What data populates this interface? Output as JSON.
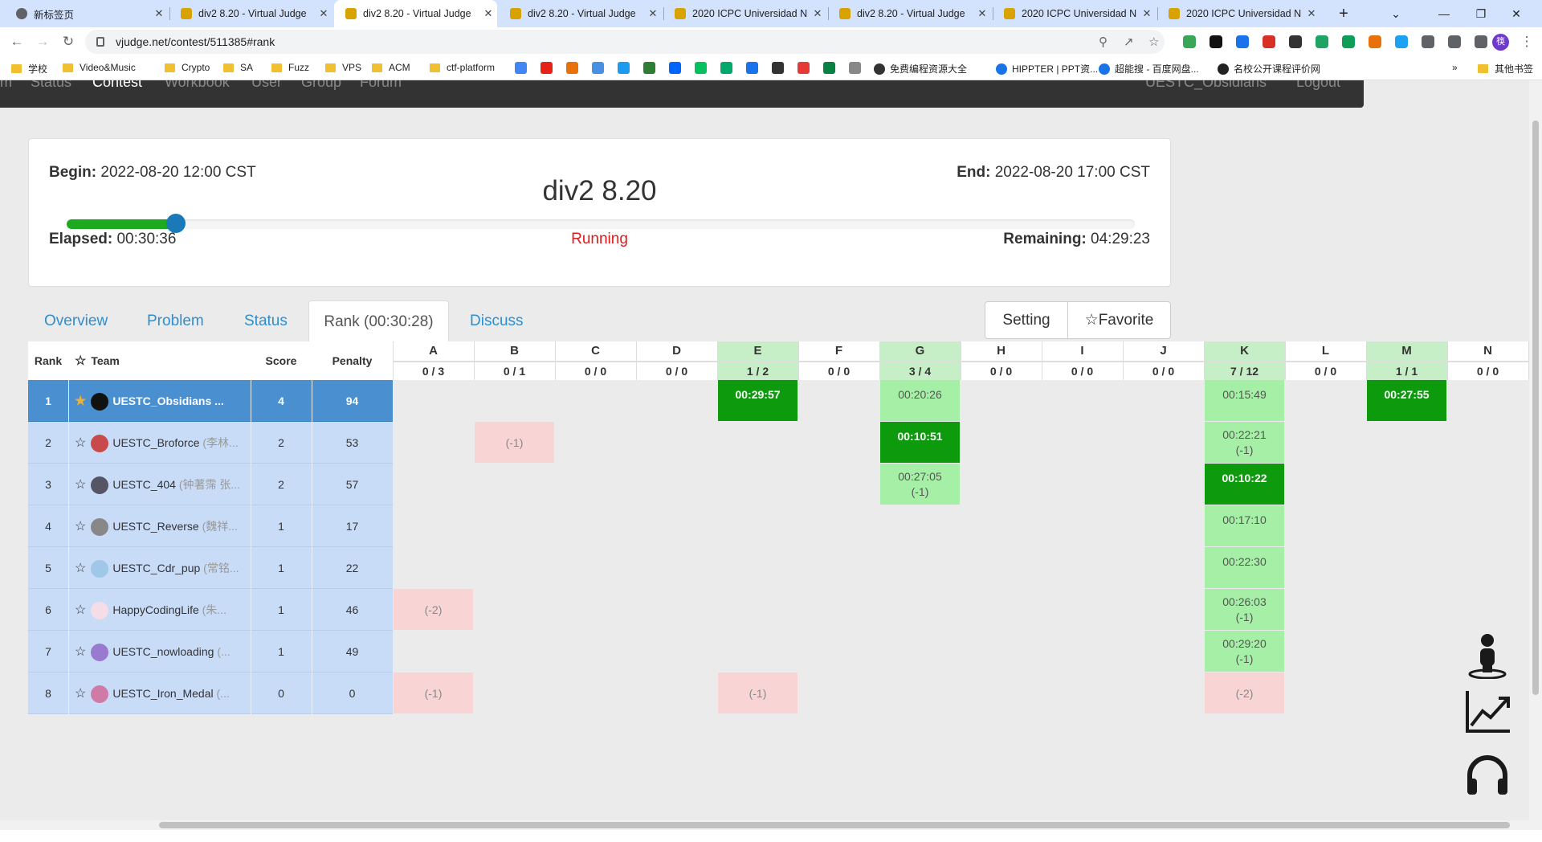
{
  "browser": {
    "tabs": [
      {
        "label": "新标签页",
        "active": false
      },
      {
        "label": "div2 8.20 - Virtual Judge",
        "active": false
      },
      {
        "label": "div2 8.20 - Virtual Judge",
        "active": true
      },
      {
        "label": "div2 8.20 - Virtual Judge",
        "active": false
      },
      {
        "label": "2020 ICPC Universidad N",
        "active": false
      },
      {
        "label": "div2 8.20 - Virtual Judge",
        "active": false
      },
      {
        "label": "2020 ICPC Universidad N",
        "active": false
      },
      {
        "label": "2020 ICPC Universidad N",
        "active": false
      }
    ],
    "new_tab": "+",
    "url": "vjudge.net/contest/511385#rank",
    "bookmarks": [
      "学校",
      "Video&Music",
      "Crypto",
      "SA",
      "Fuzz",
      "VPS",
      "ACM",
      "ctf-platform",
      "免费编程资源大全",
      "HIPPTER | PPT资...",
      "超能搜 - 百度网盘...",
      "名校公开课程评价网"
    ],
    "bookmarks_more": "»",
    "other_bookmarks": "其他书签",
    "profile_initial": "筷"
  },
  "navbar": {
    "items": [
      "m",
      "Status",
      "Contest",
      "Workbook",
      "User",
      "Group",
      "Forum"
    ],
    "user": "UESTC_Obsidians",
    "logout": "Logout"
  },
  "contest": {
    "begin_label": "Begin:",
    "begin": "2022-08-20 12:00 CST",
    "end_label": "End:",
    "end": "2022-08-20 17:00 CST",
    "title": "div2 8.20",
    "elapsed_label": "Elapsed:",
    "elapsed": "00:30:36",
    "remaining_label": "Remaining:",
    "remaining": "04:29:23",
    "status": "Running",
    "progress_fraction": 0.102
  },
  "tabs": {
    "overview": "Overview",
    "problem": "Problem",
    "status": "Status",
    "rank": "Rank (00:30:28)",
    "discuss": "Discuss"
  },
  "buttons": {
    "setting": "Setting",
    "favorite": "Favorite"
  },
  "rank_table": {
    "headers": {
      "rank": "Rank",
      "team": "Team",
      "score": "Score",
      "penalty": "Penalty"
    },
    "problems": [
      {
        "id": "A",
        "stat": "0 / 3",
        "solved": false
      },
      {
        "id": "B",
        "stat": "0 / 1",
        "solved": false
      },
      {
        "id": "C",
        "stat": "0 / 0",
        "solved": false
      },
      {
        "id": "D",
        "stat": "0 / 0",
        "solved": false
      },
      {
        "id": "E",
        "stat": "1 / 2",
        "solved": true
      },
      {
        "id": "F",
        "stat": "0 / 0",
        "solved": false
      },
      {
        "id": "G",
        "stat": "3 / 4",
        "solved": true
      },
      {
        "id": "H",
        "stat": "0 / 0",
        "solved": false
      },
      {
        "id": "I",
        "stat": "0 / 0",
        "solved": false
      },
      {
        "id": "J",
        "stat": "0 / 0",
        "solved": false
      },
      {
        "id": "K",
        "stat": "7 / 12",
        "solved": true
      },
      {
        "id": "L",
        "stat": "0 / 0",
        "solved": false
      },
      {
        "id": "M",
        "stat": "1 / 1",
        "solved": true
      },
      {
        "id": "N",
        "stat": "0 / 0",
        "solved": false
      }
    ],
    "rows": [
      {
        "rank": "1",
        "team": "UESTC_Obsidians",
        "team_sub": "...",
        "score": "4",
        "penalty": "94",
        "starred": true,
        "avatar": "#111111",
        "cells": {
          "E": {
            "t": "00:29:57",
            "k": "fb"
          },
          "G": {
            "t": "00:20:26",
            "k": "ac"
          },
          "K": {
            "t": "00:15:49",
            "k": "ac"
          },
          "M": {
            "t": "00:27:55",
            "k": "fb"
          }
        }
      },
      {
        "rank": "2",
        "team": "UESTC_Broforce",
        "team_sub": "(李林...",
        "score": "2",
        "penalty": "53",
        "starred": false,
        "avatar": "#c94a4a",
        "cells": {
          "B": {
            "t": "(-1)",
            "k": "fail"
          },
          "G": {
            "t": "00:10:51",
            "k": "fb"
          },
          "K": {
            "t": "00:22:21",
            "s": "(-1)",
            "k": "ac"
          }
        }
      },
      {
        "rank": "3",
        "team": "UESTC_404",
        "team_sub": "(钟著霈 张...",
        "score": "2",
        "penalty": "57",
        "starred": false,
        "avatar": "#555566",
        "cells": {
          "G": {
            "t": "00:27:05",
            "s": "(-1)",
            "k": "ac"
          },
          "K": {
            "t": "00:10:22",
            "k": "fb"
          }
        }
      },
      {
        "rank": "4",
        "team": "UESTC_Reverse",
        "team_sub": "(魏祥...",
        "score": "1",
        "penalty": "17",
        "starred": false,
        "avatar": "#888888",
        "cells": {
          "K": {
            "t": "00:17:10",
            "k": "ac"
          }
        }
      },
      {
        "rank": "5",
        "team": "UESTC_Cdr_pup",
        "team_sub": "(常铭...",
        "score": "1",
        "penalty": "22",
        "starred": false,
        "avatar": "#9ec7e8",
        "cells": {
          "K": {
            "t": "00:22:30",
            "k": "ac"
          }
        }
      },
      {
        "rank": "6",
        "team": "HappyCodingLife",
        "team_sub": "(朱...",
        "score": "1",
        "penalty": "46",
        "starred": false,
        "avatar": "#f5dde8",
        "cells": {
          "A": {
            "t": "(-2)",
            "k": "fail"
          },
          "K": {
            "t": "00:26:03",
            "s": "(-1)",
            "k": "ac"
          }
        }
      },
      {
        "rank": "7",
        "team": "UESTC_nowloading",
        "team_sub": "(...",
        "score": "1",
        "penalty": "49",
        "starred": false,
        "avatar": "#9a7ad0",
        "cells": {
          "K": {
            "t": "00:29:20",
            "s": "(-1)",
            "k": "ac"
          }
        }
      },
      {
        "rank": "8",
        "team": "UESTC_Iron_Medal",
        "team_sub": "(...",
        "score": "0",
        "penalty": "0",
        "starred": false,
        "avatar": "#d07aa8",
        "cells": {
          "A": {
            "t": "(-1)",
            "k": "fail"
          },
          "E": {
            "t": "(-1)",
            "k": "fail"
          },
          "K": {
            "t": "(-2)",
            "k": "fail"
          }
        }
      }
    ]
  },
  "floating_icons": [
    "person-icon",
    "chart-icon",
    "headset-icon"
  ]
}
